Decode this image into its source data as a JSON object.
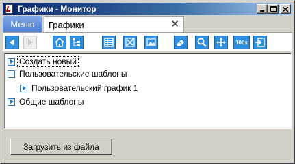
{
  "window": {
    "title": "Графики - Монитор"
  },
  "tabs": {
    "menu_label": "Меню",
    "active_label": "Графики",
    "close_glyph": "✕"
  },
  "toolbar": {
    "zoom_label": "100x",
    "buttons": [
      "back-icon",
      "forward-icon",
      "home-icon",
      "tree-icon",
      "table-icon",
      "edit-chart-icon",
      "image-icon",
      "eraser-icon",
      "zoom-icon",
      "pan-icon",
      "zoom-100-icon",
      "export-icon"
    ]
  },
  "tree": {
    "items": [
      {
        "label": "Создать новый",
        "state": "collapsed",
        "level": 0,
        "selected": true
      },
      {
        "label": "Пользовательские шаблоны",
        "state": "expanded",
        "level": 0
      },
      {
        "label": "Пользовательский график 1",
        "state": "collapsed",
        "level": 1
      },
      {
        "label": "Общие шаблоны",
        "state": "collapsed",
        "level": 0
      }
    ]
  },
  "load_button": {
    "label": "Загрузить из файла"
  },
  "colors": {
    "title_gradient_start": "#0a246a",
    "accent": "#2f8fe0",
    "menu_tab": "#5b89d6",
    "window_bg": "#d4d0c8"
  }
}
